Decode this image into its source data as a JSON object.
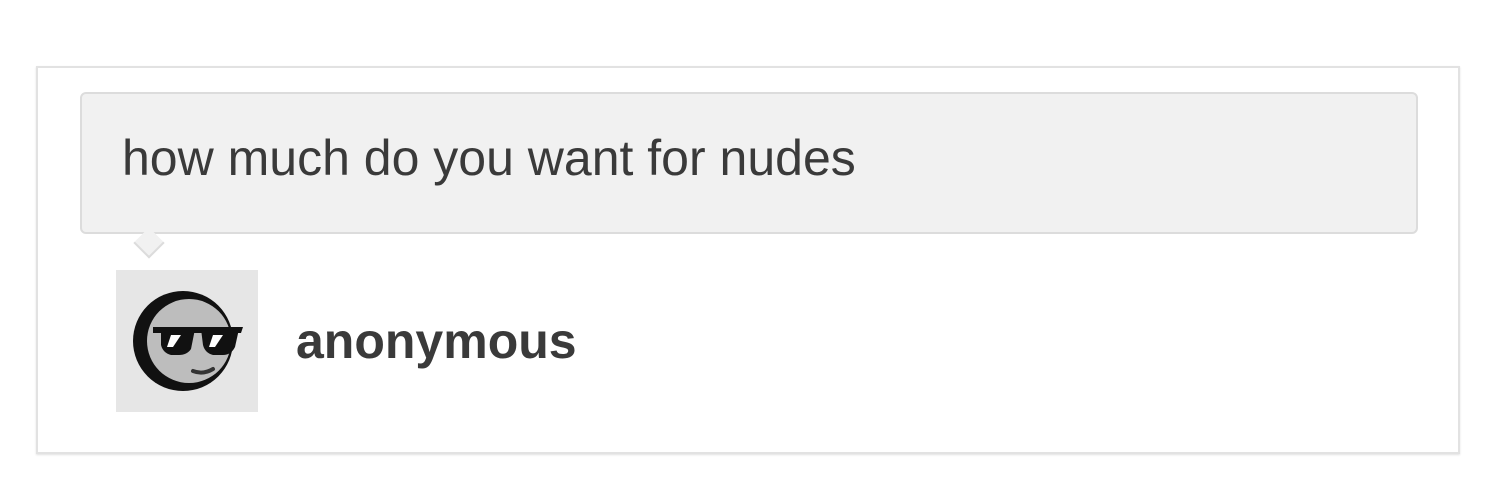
{
  "question": {
    "text": "how much do you want for nudes"
  },
  "asker": {
    "name": "anonymous",
    "avatar_icon": "anonymous-sunglasses-icon"
  },
  "colors": {
    "card_background": "#ffffff",
    "bubble_background": "#f1f1f1",
    "avatar_background": "#e6e6e6",
    "text": "#3a3a3a"
  }
}
